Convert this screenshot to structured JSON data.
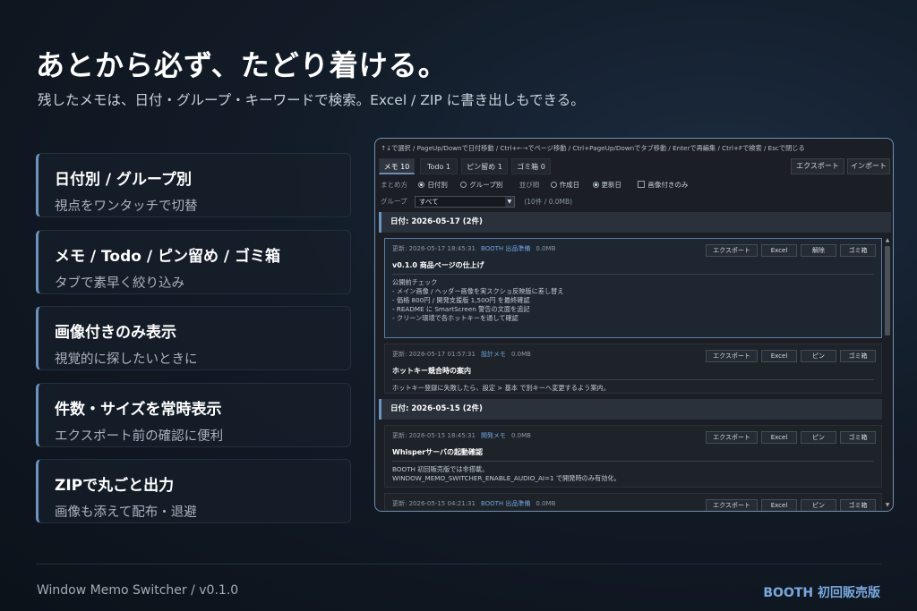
{
  "hero": {
    "headline": "あとから必ず、たどり着ける。",
    "subline": "残したメモは、日付・グループ・キーワードで検索。Excel / ZIP に書き出しもできる。"
  },
  "features": [
    {
      "title": "日付別 / グループ別",
      "desc": "視点をワンタッチで切替"
    },
    {
      "title": "メモ / Todo / ピン留め / ゴミ箱",
      "desc": "タブで素早く絞り込み"
    },
    {
      "title": "画像付きのみ表示",
      "desc": "視覚的に探したいときに"
    },
    {
      "title": "件数・サイズを常時表示",
      "desc": "エクスポート前の確認に便利"
    },
    {
      "title": "ZIPで丸ごと出力",
      "desc": "画像も添えて配布・退避"
    }
  ],
  "footer": {
    "left": "Window Memo Switcher / v0.1.0",
    "right": "BOOTH 初回販売版"
  },
  "app": {
    "help": "↑↓で選択 / PageUp/Downで日付移動 / Ctrl+←→でページ移動 / Ctrl+PageUp/Downでタブ移動 / Enterで再編集 / Ctrl+Fで検索 / Escで閉じる",
    "tabs": [
      "メモ 10",
      "Todo 1",
      "ピン留め 1",
      "ゴミ箱 0"
    ],
    "export_label": "エクスポート",
    "import_label": "インポート",
    "options": {
      "group_by_label": "まとめ方",
      "by_date": "日付別",
      "by_group": "グループ別",
      "sort_label": "並び順",
      "created": "作成日",
      "updated": "更新日",
      "images_only": "画像付きのみ"
    },
    "group_filter": {
      "label": "グループ",
      "value": "すべて",
      "count": "(10件 / 0.0MB)"
    },
    "sections": [
      {
        "header": "日付: 2026-05-17  (2件)",
        "cards": [
          {
            "updated": "更新: 2026-05-17 18:45:31",
            "group": "BOOTH 出品準備",
            "size": "0.0MB",
            "actions": [
              "エクスポート",
              "Excel",
              "解除",
              "ゴミ箱"
            ],
            "title": "v0.1.0 商品ページの仕上げ",
            "body": "公開前チェック\n- メイン画像 / ヘッダー画像を実スクショ反映版に差し替え\n- 価格 800円 / 開発支援版 1,500円 を最終確認\n- README に SmartScreen 警告の文面を追記\n- クリーン環境で各ホットキーを通して確認",
            "selected": true
          },
          {
            "updated": "更新: 2026-05-17 01:57:31",
            "group": "設計メモ",
            "size": "0.0MB",
            "actions": [
              "エクスポート",
              "Excel",
              "ピン",
              "ゴミ箱"
            ],
            "title": "ホットキー競合時の案内",
            "body": "ホットキー登録に失敗したら、設定 > 基本 で別キーへ変更するよう案内。",
            "selected": false
          }
        ]
      },
      {
        "header": "日付: 2026-05-15  (2件)",
        "cards": [
          {
            "updated": "更新: 2026-05-15 18:45:31",
            "group": "開発メモ",
            "size": "0.0MB",
            "actions": [
              "エクスポート",
              "Excel",
              "ピン",
              "ゴミ箱"
            ],
            "title": "Whisperサーバの起動確認",
            "body": "BOOTH 初回販売版では非搭載。\nWINDOW_MEMO_SWITCHER_ENABLE_AUDIO_AI=1 で開発時のみ有効化。",
            "selected": false
          },
          {
            "updated": "更新: 2026-05-15 04:21:31",
            "group": "BOOTH 出品準備",
            "size": "0.0MB",
            "actions": [
              "エクスポート",
              "Excel",
              "ピン",
              "ゴミ箱"
            ],
            "title": "",
            "body": "",
            "selected": false
          }
        ]
      }
    ]
  },
  "colors": {
    "accent": "#6d93c0",
    "booth_blue": "#7aa9df",
    "group_link": "#6fa3e0"
  }
}
